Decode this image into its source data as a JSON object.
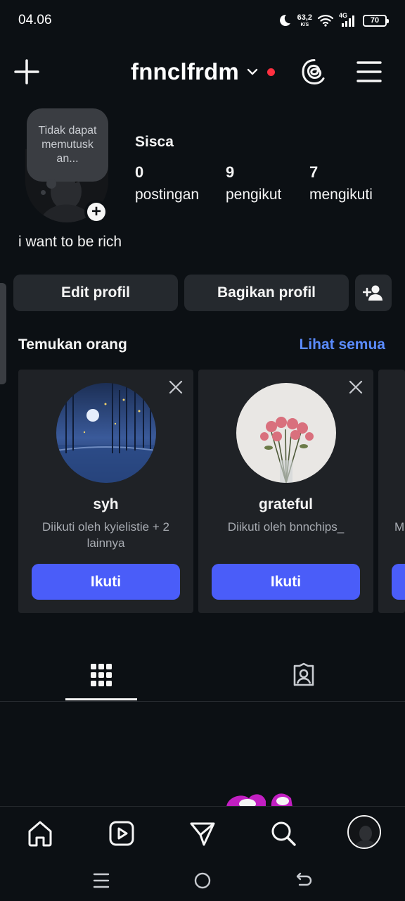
{
  "status_bar": {
    "time": "04.06",
    "net_speed": "63,2",
    "net_unit": "K/S",
    "network": "4G",
    "battery": "70",
    "icons": [
      "moon-icon",
      "wifi-icon",
      "signal-icon",
      "battery-icon"
    ]
  },
  "header": {
    "username": "fnnclfrdm",
    "icons": [
      "plus-icon",
      "chevron-down-icon",
      "threads-icon",
      "menu-icon"
    ],
    "notification_dot_color": "#ff3040"
  },
  "profile": {
    "note": "Tidak dapat memutusk an...",
    "display_name": "Sisca",
    "stats": [
      {
        "value": "0",
        "label": "postingan"
      },
      {
        "value": "9",
        "label": "pengikut"
      },
      {
        "value": "7",
        "label": "mengikuti"
      }
    ],
    "bio": "i want to be rich"
  },
  "actions": {
    "edit_profile": "Edit profil",
    "share_profile": "Bagikan profil"
  },
  "discover": {
    "title": "Temukan orang",
    "see_all": "Lihat semua",
    "cards": [
      {
        "name": "syh",
        "subtitle": "Diikuti oleh kyielistie + 2 lainnya",
        "follow_label": "Ikuti"
      },
      {
        "name": "grateful",
        "subtitle": "Diikuti oleh bnnchips_",
        "follow_label": "Ikuti"
      },
      {
        "name": "",
        "subtitle": "M",
        "follow_label": ""
      }
    ]
  },
  "tabs": [
    "grid-icon",
    "tagged-icon"
  ],
  "bottom_nav": [
    "home-icon",
    "reels-icon",
    "send-icon",
    "search-icon",
    "profile-avatar"
  ],
  "colors": {
    "background": "#0c1014",
    "button": "#25292e",
    "accent_blue": "#4a5df9",
    "link_blue": "#5b8cff",
    "card": "#1f2226"
  }
}
